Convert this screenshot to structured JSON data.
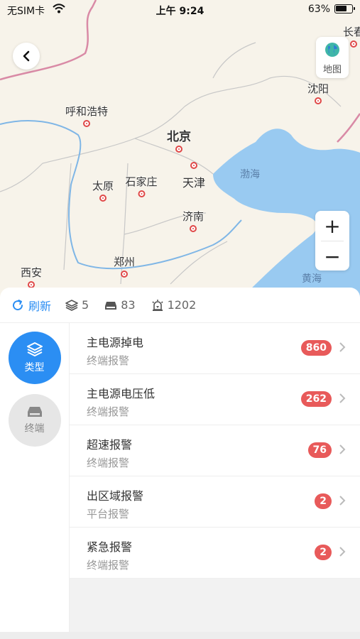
{
  "status_bar": {
    "carrier": "无SIM卡",
    "time": "上午 9:24",
    "battery": "63%"
  },
  "map": {
    "layer_button_label": "地图",
    "zoom_in": "+",
    "zoom_out": "−",
    "cities": [
      {
        "name": "呼和浩特"
      },
      {
        "name": "北京"
      },
      {
        "name": "天津"
      },
      {
        "name": "太原"
      },
      {
        "name": "石家庄"
      },
      {
        "name": "济南"
      },
      {
        "name": "郑州"
      },
      {
        "name": "西安"
      },
      {
        "name": "沈阳"
      },
      {
        "name": "长春"
      }
    ],
    "seas": [
      "渤海",
      "黄海"
    ]
  },
  "toolbar": {
    "refresh_label": "刷新",
    "layers_count": "5",
    "terminals_count": "83",
    "alarms_count": "1202"
  },
  "side_tabs": [
    {
      "label": "类型",
      "active": true
    },
    {
      "label": "终端",
      "active": false
    }
  ],
  "alarm_list": [
    {
      "title": "主电源掉电",
      "subtitle": "终端报警",
      "count": "860"
    },
    {
      "title": "主电源电压低",
      "subtitle": "终端报警",
      "count": "262"
    },
    {
      "title": "超速报警",
      "subtitle": "终端报警",
      "count": "76"
    },
    {
      "title": "出区域报警",
      "subtitle": "平台报警",
      "count": "2"
    },
    {
      "title": "紧急报警",
      "subtitle": "终端报警",
      "count": "2"
    }
  ],
  "colors": {
    "accent": "#2b8ef3",
    "badge": "#e85a5a",
    "sea": "#8ec5f2",
    "land": "#f7f3ea"
  }
}
